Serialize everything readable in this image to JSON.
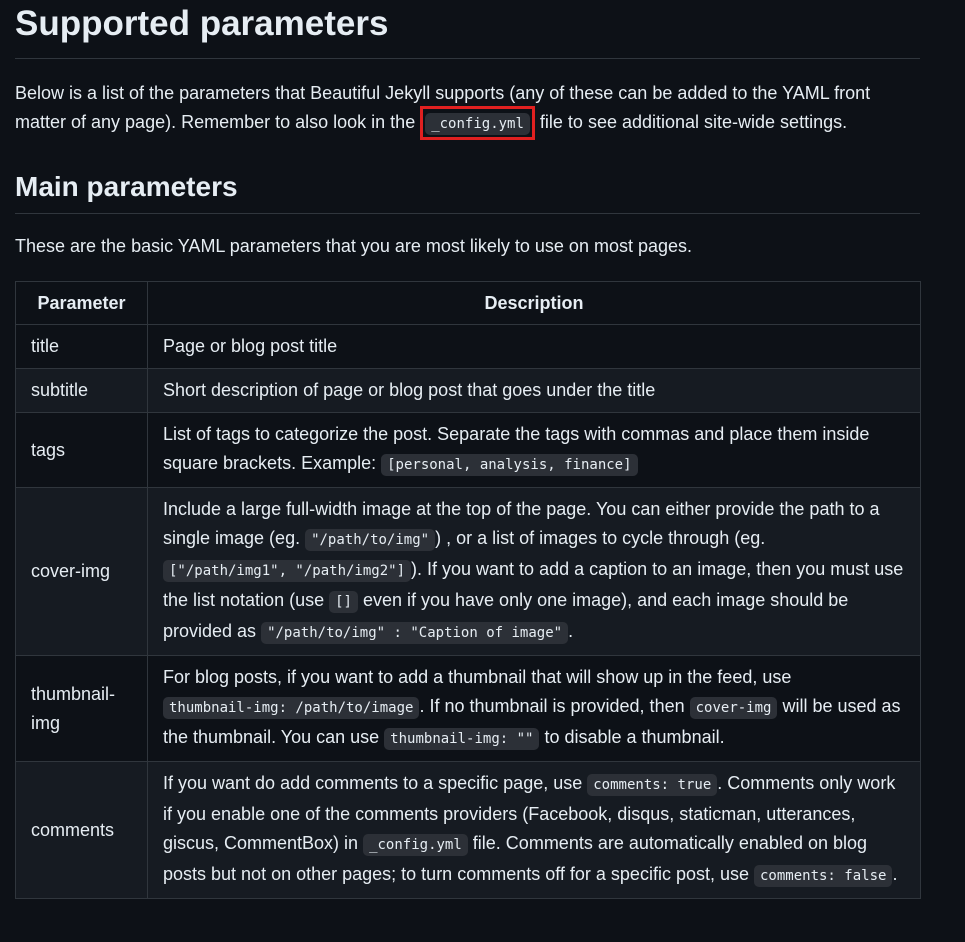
{
  "heading": "Supported parameters",
  "intro": {
    "before": "Below is a list of the parameters that Beautiful Jekyll supports (any of these can be added to the YAML front matter of any page). Remember to also look in the ",
    "code": "_config.yml",
    "after": " file to see additional site-wide settings."
  },
  "subheading": "Main parameters",
  "basic_text": "These are the basic YAML parameters that you are most likely to use on most pages.",
  "table": {
    "headers": [
      "Parameter",
      "Description"
    ],
    "rows": [
      {
        "param": "title",
        "desc": "Page or blog post title"
      },
      {
        "param": "subtitle",
        "desc": "Short description of page or blog post that goes under the title"
      },
      {
        "param": "tags",
        "desc_parts": [
          "List of tags to categorize the post. Separate the tags with commas and place them inside square brackets. Example: ",
          "[personal, analysis, finance]"
        ]
      },
      {
        "param": "cover-img",
        "desc_parts": [
          "Include a large full-width image at the top of the page. You can either provide the path to a single image (eg. ",
          "\"/path/to/img\"",
          ") , or a list of images to cycle through (eg. ",
          "[\"/path/img1\", \"/path/img2\"]",
          "). If you want to add a caption to an image, then you must use the list notation (use ",
          "[]",
          " even if you have only one image), and each image should be provided as ",
          "\"/path/to/img\" : \"Caption of image\"",
          "."
        ]
      },
      {
        "param": "thumbnail-img",
        "desc_parts": [
          "For blog posts, if you want to add a thumbnail that will show up in the feed, use ",
          "thumbnail-img: /path/to/image",
          ". If no thumbnail is provided, then ",
          "cover-img",
          " will be used as the thumbnail. You can use ",
          "thumbnail-img: \"\"",
          " to disable a thumbnail."
        ]
      },
      {
        "param": "comments",
        "desc_parts": [
          "If you want do add comments to a specific page, use ",
          "comments: true",
          ". Comments only work if you enable one of the comments providers (Facebook, disqus, staticman, utterances, giscus, CommentBox) in ",
          "_config.yml",
          " file. Comments are automatically enabled on blog posts but not on other pages; to turn comments off for a specific post, use ",
          "comments: false",
          "."
        ]
      }
    ]
  }
}
